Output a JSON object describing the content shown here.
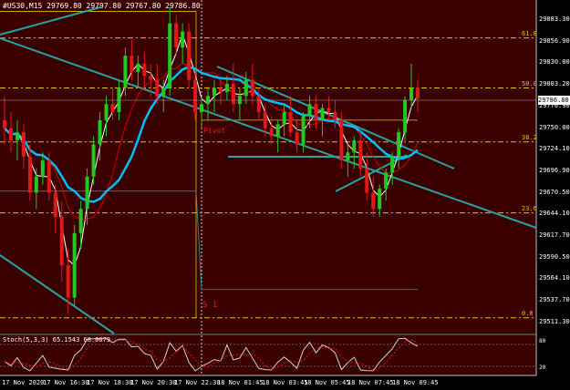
{
  "window": {
    "title": "#US30,M15  29769.80 29797.80 29767.80 29786.80",
    "stoch_label": "Stoch(5,3,3) 65.1543 68.0079"
  },
  "price_axis": {
    "labels": [
      "29883.30",
      "29856.90",
      "29830.00",
      "29803.20",
      "29776.90",
      "29750.00",
      "29724.10",
      "29696.90",
      "29670.50",
      "29644.10",
      "29617.70",
      "29590.50",
      "29564.10",
      "29537.70",
      "29511.30"
    ],
    "current_price": "29786.80"
  },
  "fib_levels": [
    {
      "label": "61.8",
      "price": 29862
    },
    {
      "label": "50.0",
      "price": 29800
    },
    {
      "label": "38.2",
      "price": 29733
    },
    {
      "label": "23.6",
      "price": 29645
    },
    {
      "label": "0.0",
      "price": 29515
    }
  ],
  "pivot": {
    "label": "Pivot",
    "price": 29760
  },
  "support": {
    "label": "S 1",
    "price": 29550
  },
  "stoch_axis": {
    "top": "80",
    "bottom": "20"
  },
  "time_axis": {
    "labels": [
      "17 Nov 2020",
      "17 Nov 16:30",
      "17 Nov 18:30",
      "17 Nov 20:30",
      "17 Nov 22:30",
      "18 Nov 01:45",
      "18 Nov 03:45",
      "18 Nov 05:45",
      "18 Nov 07:45",
      "18 Nov 09:45"
    ]
  },
  "colors": {
    "background": "#3a0000",
    "bull": "#22c922",
    "bear": "#e01818",
    "ma_fast": "#ffffff",
    "ma_mid": "#00bfff",
    "ma_slow": "#cc0000",
    "trendline": "#2aa0a0",
    "fib": "#e6c200",
    "grid": "#ffffff"
  },
  "chart_data": {
    "type": "candlestick",
    "symbol": "#US30",
    "timeframe": "M15",
    "ylim": [
      29500,
      29900
    ],
    "candles": [
      [
        29760,
        29790,
        29730,
        29750
      ],
      [
        29750,
        29770,
        29720,
        29735
      ],
      [
        29735,
        29760,
        29710,
        29745
      ],
      [
        29745,
        29755,
        29700,
        29715
      ],
      [
        29715,
        29730,
        29660,
        29670
      ],
      [
        29670,
        29700,
        29650,
        29690
      ],
      [
        29690,
        29720,
        29680,
        29710
      ],
      [
        29710,
        29720,
        29660,
        29670
      ],
      [
        29670,
        29680,
        29620,
        29640
      ],
      [
        29640,
        29660,
        29560,
        29580
      ],
      [
        29580,
        29600,
        29520,
        29540
      ],
      [
        29540,
        29630,
        29530,
        29620
      ],
      [
        29620,
        29660,
        29600,
        29650
      ],
      [
        29650,
        29700,
        29630,
        29690
      ],
      [
        29690,
        29740,
        29680,
        29730
      ],
      [
        29730,
        29770,
        29710,
        29760
      ],
      [
        29760,
        29790,
        29740,
        29780
      ],
      [
        29780,
        29800,
        29760,
        29770
      ],
      [
        29770,
        29810,
        29760,
        29800
      ],
      [
        29800,
        29850,
        29790,
        29840
      ],
      [
        29840,
        29860,
        29810,
        29820
      ],
      [
        29820,
        29840,
        29800,
        29830
      ],
      [
        29830,
        29845,
        29800,
        29815
      ],
      [
        29815,
        29830,
        29790,
        29810
      ],
      [
        29810,
        29830,
        29780,
        29790
      ],
      [
        29790,
        29810,
        29770,
        29800
      ],
      [
        29800,
        29900,
        29790,
        29880
      ],
      [
        29880,
        29890,
        29840,
        29850
      ],
      [
        29850,
        29880,
        29830,
        29870
      ],
      [
        29870,
        29880,
        29800,
        29810
      ],
      [
        29810,
        29820,
        29760,
        29770
      ],
      [
        29770,
        29790,
        29750,
        29780
      ],
      [
        29780,
        29800,
        29760,
        29790
      ],
      [
        29790,
        29810,
        29770,
        29800
      ],
      [
        29800,
        29810,
        29780,
        29795
      ],
      [
        29795,
        29815,
        29785,
        29805
      ],
      [
        29805,
        29830,
        29770,
        29780
      ],
      [
        29780,
        29800,
        29760,
        29790
      ],
      [
        29790,
        29820,
        29780,
        29810
      ],
      [
        29810,
        29830,
        29780,
        29790
      ],
      [
        29790,
        29800,
        29760,
        29770
      ],
      [
        29770,
        29780,
        29740,
        29750
      ],
      [
        29750,
        29765,
        29730,
        29740
      ],
      [
        29740,
        29760,
        29720,
        29755
      ],
      [
        29755,
        29780,
        29740,
        29770
      ],
      [
        29770,
        29790,
        29740,
        29745
      ],
      [
        29745,
        29760,
        29720,
        29730
      ],
      [
        29730,
        29770,
        29720,
        29765
      ],
      [
        29765,
        29790,
        29750,
        29780
      ],
      [
        29780,
        29790,
        29750,
        29760
      ],
      [
        29760,
        29780,
        29740,
        29775
      ],
      [
        29775,
        29790,
        29760,
        29770
      ],
      [
        29770,
        29785,
        29750,
        29760
      ],
      [
        29760,
        29770,
        29700,
        29710
      ],
      [
        29710,
        29730,
        29690,
        29720
      ],
      [
        29720,
        29740,
        29700,
        29735
      ],
      [
        29735,
        29750,
        29690,
        29700
      ],
      [
        29700,
        29720,
        29660,
        29670
      ],
      [
        29670,
        29690,
        29640,
        29650
      ],
      [
        29650,
        29680,
        29640,
        29675
      ],
      [
        29675,
        29700,
        29660,
        29695
      ],
      [
        29695,
        29720,
        29680,
        29715
      ],
      [
        29715,
        29750,
        29700,
        29745
      ],
      [
        29745,
        29790,
        29735,
        29785
      ],
      [
        29785,
        29830,
        29775,
        29800
      ],
      [
        29800,
        29810,
        29770,
        29787
      ]
    ]
  }
}
